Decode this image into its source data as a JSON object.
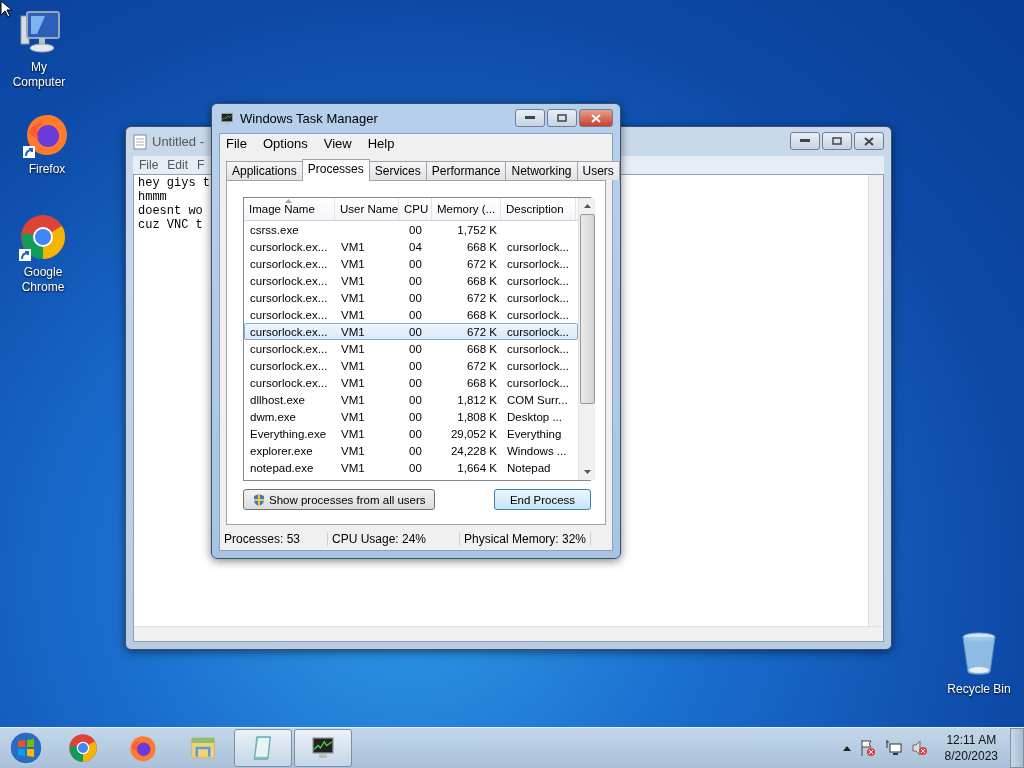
{
  "desktop_icons": [
    {
      "label": "My Computer",
      "kind": "computer"
    },
    {
      "label": "Firefox",
      "kind": "firefox"
    },
    {
      "label": "Google Chrome",
      "kind": "chrome"
    },
    {
      "label": "Recycle Bin",
      "kind": "recycle"
    }
  ],
  "notepad": {
    "title": "Untitled - ",
    "menu": [
      "File",
      "Edit",
      "F"
    ],
    "lines": [
      "hey giys t",
      "hmmm",
      "doesnt wo",
      "cuz VNC t"
    ]
  },
  "task_manager": {
    "title": "Windows Task Manager",
    "menu": [
      "File",
      "Options",
      "View",
      "Help"
    ],
    "tabs": [
      {
        "label": "Applications",
        "selected": false
      },
      {
        "label": "Processes",
        "selected": true
      },
      {
        "label": "Services",
        "selected": false
      },
      {
        "label": "Performance",
        "selected": false
      },
      {
        "label": "Networking",
        "selected": false
      },
      {
        "label": "Users",
        "selected": false
      }
    ],
    "columns": [
      {
        "label": "Image Name",
        "sorted": true
      },
      {
        "label": "User Name",
        "sorted": false
      },
      {
        "label": "CPU",
        "sorted": false
      },
      {
        "label": "Memory (...",
        "sorted": false
      },
      {
        "label": "Description",
        "sorted": false
      }
    ],
    "rows": [
      {
        "image": "csrss.exe",
        "user": "",
        "cpu": "00",
        "memory": "1,752 K",
        "description": "",
        "selected": false
      },
      {
        "image": "cursorlock.ex...",
        "user": "VM1",
        "cpu": "04",
        "memory": "668 K",
        "description": "cursorlock...",
        "selected": false
      },
      {
        "image": "cursorlock.ex...",
        "user": "VM1",
        "cpu": "00",
        "memory": "672 K",
        "description": "cursorlock...",
        "selected": false
      },
      {
        "image": "cursorlock.ex...",
        "user": "VM1",
        "cpu": "00",
        "memory": "668 K",
        "description": "cursorlock...",
        "selected": false
      },
      {
        "image": "cursorlock.ex...",
        "user": "VM1",
        "cpu": "00",
        "memory": "672 K",
        "description": "cursorlock...",
        "selected": false
      },
      {
        "image": "cursorlock.ex...",
        "user": "VM1",
        "cpu": "00",
        "memory": "668 K",
        "description": "cursorlock...",
        "selected": false
      },
      {
        "image": "cursorlock.ex...",
        "user": "VM1",
        "cpu": "00",
        "memory": "672 K",
        "description": "cursorlock...",
        "selected": true
      },
      {
        "image": "cursorlock.ex...",
        "user": "VM1",
        "cpu": "00",
        "memory": "668 K",
        "description": "cursorlock...",
        "selected": false
      },
      {
        "image": "cursorlock.ex...",
        "user": "VM1",
        "cpu": "00",
        "memory": "672 K",
        "description": "cursorlock...",
        "selected": false
      },
      {
        "image": "cursorlock.ex...",
        "user": "VM1",
        "cpu": "00",
        "memory": "668 K",
        "description": "cursorlock...",
        "selected": false
      },
      {
        "image": "dllhost.exe",
        "user": "VM1",
        "cpu": "00",
        "memory": "1,812 K",
        "description": "COM Surr...",
        "selected": false
      },
      {
        "image": "dwm.exe",
        "user": "VM1",
        "cpu": "00",
        "memory": "1,808 K",
        "description": "Desktop ...",
        "selected": false
      },
      {
        "image": "Everything.exe",
        "user": "VM1",
        "cpu": "00",
        "memory": "29,052 K",
        "description": "Everything",
        "selected": false
      },
      {
        "image": "explorer.exe",
        "user": "VM1",
        "cpu": "00",
        "memory": "24,228 K",
        "description": "Windows ...",
        "selected": false
      },
      {
        "image": "notepad.exe",
        "user": "VM1",
        "cpu": "00",
        "memory": "1,664 K",
        "description": "Notepad",
        "selected": false
      }
    ],
    "show_all_button": "Show processes from all users",
    "end_button": "End Process",
    "status_bar": [
      "Processes: 53",
      "CPU Usage: 24%",
      "Physical Memory: 32%"
    ]
  },
  "taskbar": {
    "apps": [
      {
        "kind": "chrome",
        "active": false
      },
      {
        "kind": "firefox",
        "active": false
      },
      {
        "kind": "explorer",
        "active": false
      },
      {
        "kind": "notepad",
        "active": true
      },
      {
        "kind": "taskmgr",
        "active": true
      }
    ],
    "clock": {
      "time": "12:11 AM",
      "date": "8/20/2023"
    }
  }
}
